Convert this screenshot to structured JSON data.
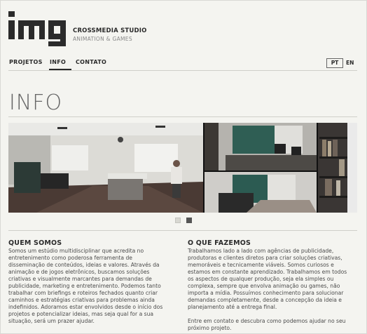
{
  "brand": {
    "logo_text": "img",
    "studio_name": "CROSSMEDIA STUDIO",
    "studio_tagline": "ANIMATION & GAMES"
  },
  "nav": {
    "items": [
      {
        "label": "PROJETOS",
        "active": false
      },
      {
        "label": "INFO",
        "active": true
      },
      {
        "label": "CONTATO",
        "active": false
      }
    ]
  },
  "language": {
    "pt": "PT",
    "en": "EN",
    "selected": "PT"
  },
  "page": {
    "title": "INFO"
  },
  "gallery": {
    "image_count": 2,
    "active_index": 1
  },
  "sections": {
    "quem_somos": {
      "title": "QUEM SOMOS",
      "lines": [
        "Somos um estúdio multidisciplinar que acredita no",
        "entretenimento como poderosa ferramenta de",
        "disseminação de conteúdos, ideias e valores. Através da",
        "animação e de jogos eletrônicos, buscamos soluções",
        "criativas e visualmente marcantes para demandas de",
        "publicidade, marketing e entretenimento. Podemos tanto",
        "trabalhar com briefings e roteiros fechados quanto criar",
        "caminhos e estratégias criativas para problemas ainda",
        "indefinidos. Adoramos estar envolvidos desde o início dos",
        "projetos e potencializar ideias, mas seja qual for a sua",
        "situação, será um prazer ajudar."
      ]
    },
    "o_que_fazemos": {
      "title": "O QUE FAZEMOS",
      "lines": [
        "Trabalhamos lado a lado com agências de publicidade,",
        "produtoras e clientes diretos para criar soluções criativas,",
        "memoráveis e tecnicamente viáveis. Somos curiosos e",
        "estamos em constante aprendizado. Trabalhamos em todos",
        "os aspectos de qualquer produção, seja ela simples ou",
        "complexa, sempre que envolva animação ou games, não",
        "importa a mídia. Possuímos conhecimento para solucionar",
        "demandas completamente, desde a concepção da ideia e",
        "planejamento até a entrega final."
      ],
      "closing_lines": [
        "Entre em contato e descubra como podemos ajudar no seu",
        "próximo projeto."
      ]
    }
  }
}
